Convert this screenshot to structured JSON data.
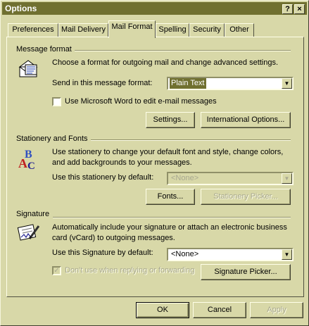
{
  "window": {
    "title": "Options",
    "help_button": "?",
    "close_button": "×"
  },
  "tabs": [
    {
      "label": "Preferences"
    },
    {
      "label": "Mail Delivery"
    },
    {
      "label": "Mail Format"
    },
    {
      "label": "Spelling"
    },
    {
      "label": "Security"
    },
    {
      "label": "Other"
    }
  ],
  "active_tab": "Mail Format",
  "message_format": {
    "title": "Message format",
    "description": "Choose a format for outgoing mail and change advanced settings.",
    "send_label": "Send in this message format:",
    "send_value": "Plain Text",
    "word_checkbox_label": "Use Microsoft Word to edit e-mail messages",
    "word_checked": false,
    "settings_button": "Settings...",
    "intl_button": "International Options..."
  },
  "stationery": {
    "title": "Stationery and Fonts",
    "description_line1": "Use stationery to change your default font and style, change colors,",
    "description_line2": "and add backgrounds to your messages.",
    "use_label": "Use this stationery by default:",
    "use_value": "<None>",
    "fonts_button": "Fonts...",
    "picker_button": "Stationery Picker..."
  },
  "signature": {
    "title": "Signature",
    "description_line1": "Automatically include your signature or attach an electronic business",
    "description_line2": "card (vCard) to outgoing messages.",
    "use_label": "Use this Signature by default:",
    "use_value": "<None>",
    "dont_use_label": "Don't use when replying or forwarding",
    "dont_use_checked": true,
    "picker_button": "Signature Picker..."
  },
  "footer": {
    "ok": "OK",
    "cancel": "Cancel",
    "apply": "Apply"
  },
  "colors": {
    "face": "#d8d8a8",
    "titlebar": "#707030",
    "selection": "#707030"
  }
}
